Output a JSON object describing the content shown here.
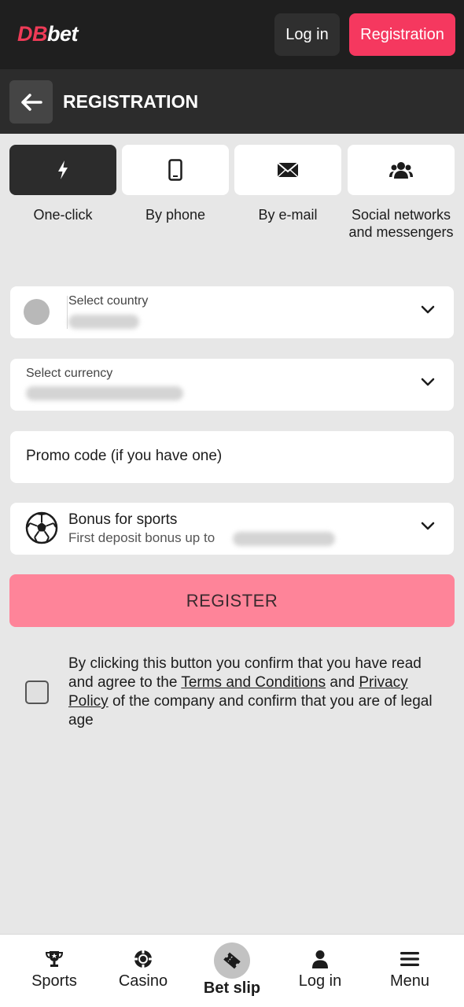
{
  "header": {
    "logo_prefix": "DB",
    "logo_suffix": "bet",
    "login_label": "Log in",
    "registration_label": "Registration"
  },
  "page": {
    "title": "REGISTRATION"
  },
  "tabs": [
    {
      "label": "One-click",
      "icon": "lightning-icon",
      "active": true
    },
    {
      "label": "By phone",
      "icon": "phone-icon",
      "active": false
    },
    {
      "label": "By e-mail",
      "icon": "envelope-icon",
      "active": false
    },
    {
      "label": "Social networks and messengers",
      "icon": "users-icon",
      "active": false
    }
  ],
  "form": {
    "country_label": "Select country",
    "currency_label": "Select currency",
    "promo_placeholder": "Promo code (if you have one)",
    "bonus_title": "Bonus for sports",
    "bonus_subtitle": "First deposit bonus up to",
    "register_label": "REGISTER"
  },
  "consent": {
    "text_1": "By clicking this button you confirm that you have read and agree to the ",
    "terms_link": "Terms and Conditions",
    "text_2": " and ",
    "privacy_link": "Privacy Policy",
    "text_3": " of the company and confirm that you are of legal age"
  },
  "bottom_nav": [
    {
      "label": "Sports",
      "icon": "trophy-icon"
    },
    {
      "label": "Casino",
      "icon": "casino-chip-icon"
    },
    {
      "label": "Bet slip",
      "icon": "ticket-icon"
    },
    {
      "label": "Log in",
      "icon": "user-icon"
    },
    {
      "label": "Menu",
      "icon": "hamburger-icon"
    }
  ],
  "colors": {
    "brand_red": "#f5385f",
    "register_pink": "#fe8499",
    "header_dark": "#1f1f1f"
  }
}
